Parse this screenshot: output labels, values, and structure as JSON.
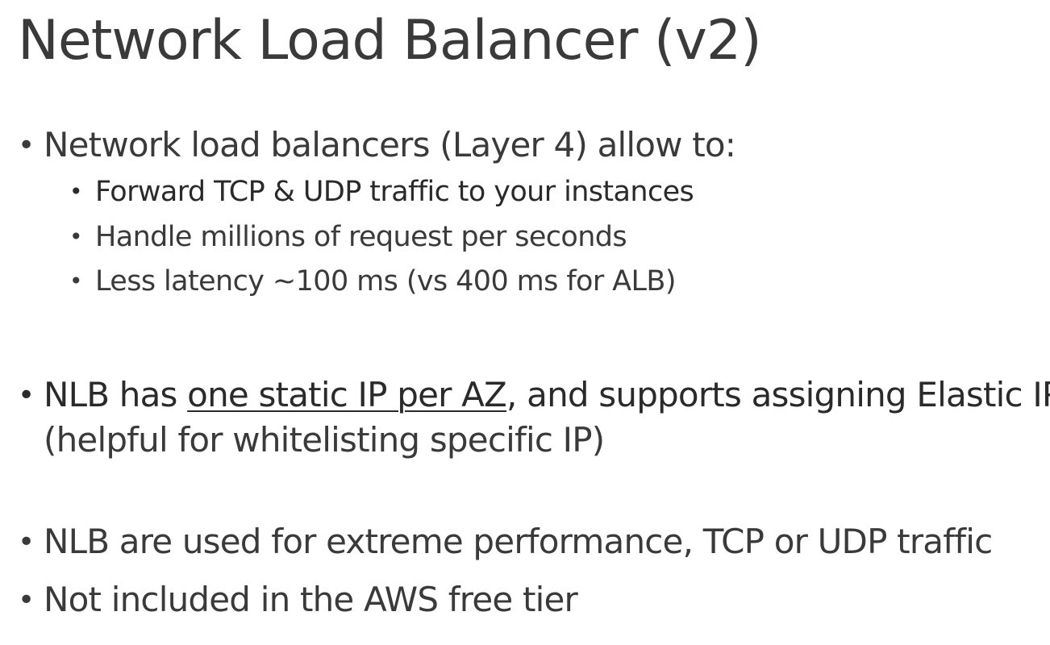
{
  "slide": {
    "title": "Network Load Balancer (v2)",
    "bullet_glyph": "•",
    "bullet1": {
      "text": "Network load balancers (Layer 4) allow to:",
      "sub": [
        "Forward TCP & UDP traffic to your instances",
        "Handle millions of request per seconds",
        "Less latency ~100 ms (vs 400 ms for ALB)"
      ]
    },
    "bullet2": {
      "prefix": "NLB has ",
      "underlined": "one static IP per AZ",
      "suffix": ", and supports assigning Elastic IP",
      "continuation": "(helpful for whitelisting specific IP)"
    },
    "bullet3": "NLB are used for extreme performance, TCP or UDP traffic",
    "bullet4": "Not included in the AWS free tier"
  }
}
